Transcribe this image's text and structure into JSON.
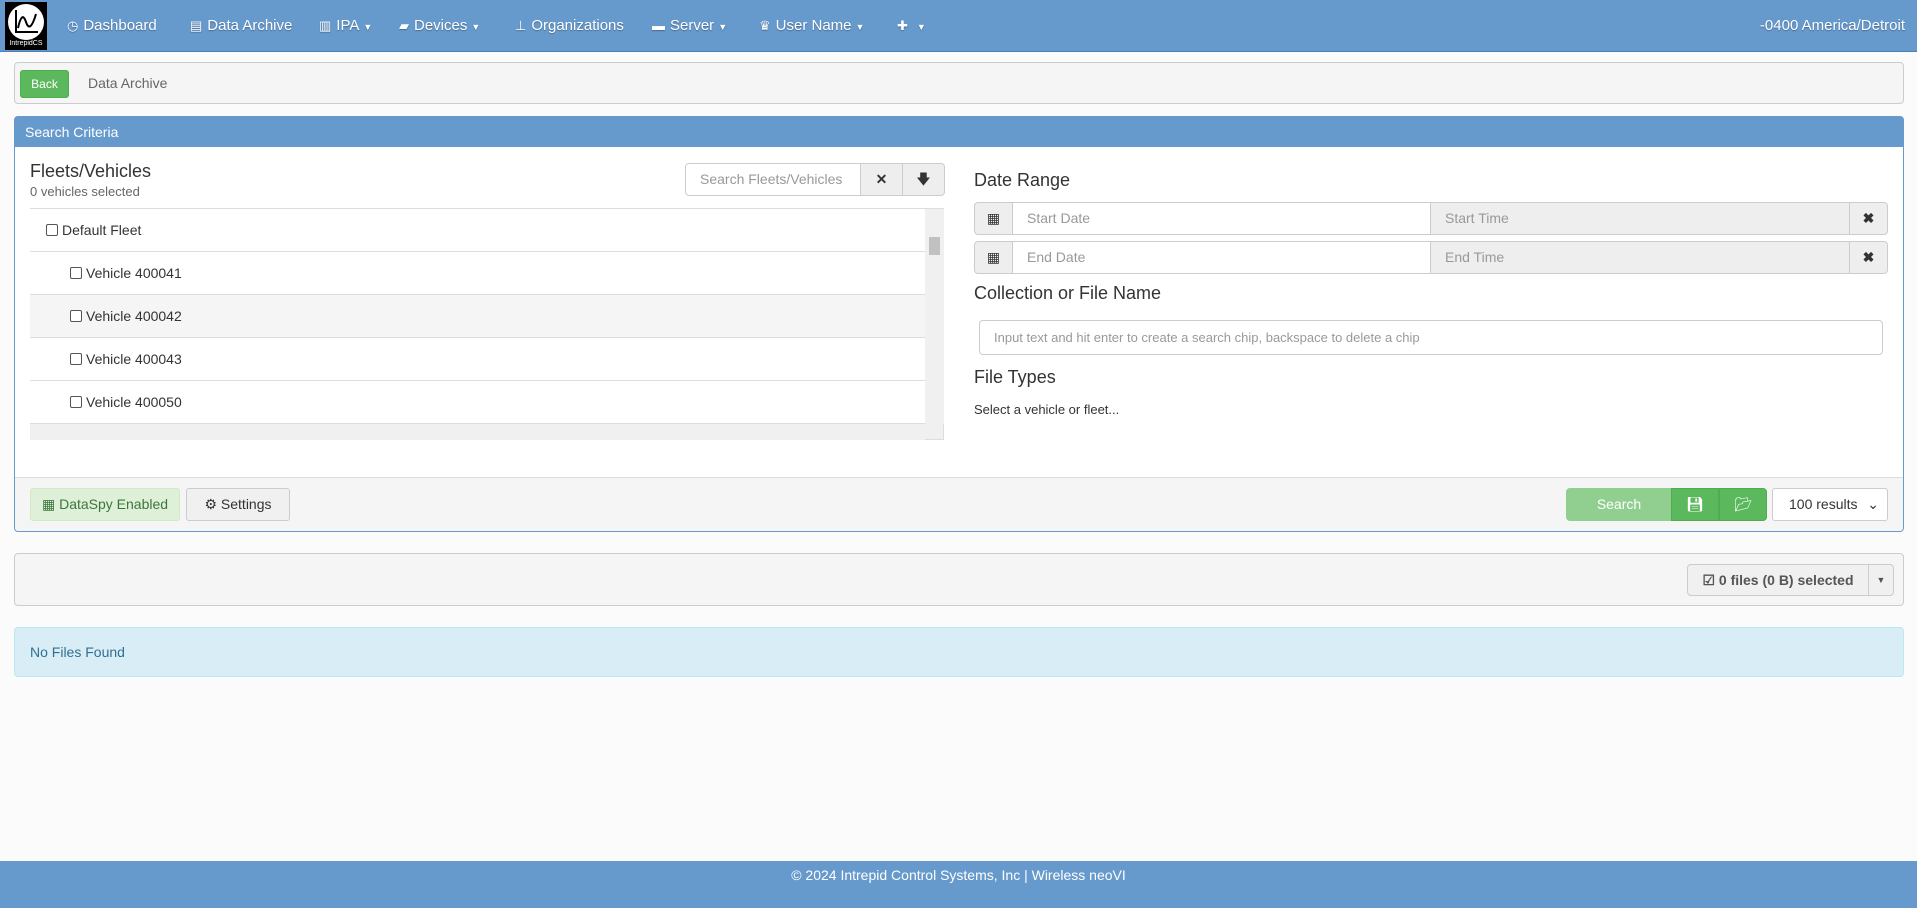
{
  "nav": {
    "logo_text": "IntrepidCS",
    "items": [
      {
        "label": "Dashboard",
        "icon": "dashboard-icon",
        "glyph": "◷",
        "caret": false
      },
      {
        "label": "Data Archive",
        "icon": "archive-icon",
        "glyph": "▤",
        "caret": false
      },
      {
        "label": "IPA",
        "icon": "beer-icon",
        "glyph": "▥",
        "caret": true
      },
      {
        "label": "Devices",
        "icon": "device-icon",
        "glyph": "▰",
        "caret": true
      },
      {
        "label": "Organizations",
        "icon": "sitemap-icon",
        "glyph": "⊥",
        "caret": false
      },
      {
        "label": "Server",
        "icon": "server-icon",
        "glyph": "▬",
        "caret": true
      },
      {
        "label": "User Name",
        "icon": "crown-icon",
        "glyph": "♛",
        "caret": true
      },
      {
        "label": "",
        "icon": "plus-icon",
        "glyph": "✚",
        "caret": true
      }
    ],
    "timezone": "-0400 America/Detroit"
  },
  "breadcrumb": {
    "back": "Back",
    "current": "Data Archive"
  },
  "search": {
    "header": "Search Criteria",
    "fleets": {
      "title": "Fleets/Vehicles",
      "count": "0 vehicles selected",
      "placeholder": "Search Fleets/Vehicles",
      "items": [
        "Default Fleet",
        "Vehicle 400041",
        "Vehicle 400042",
        "Vehicle 400043",
        "Vehicle 400050"
      ]
    },
    "date_range": {
      "title": "Date Range",
      "start_date": "Start Date",
      "start_time": "Start Time",
      "end_date": "End Date",
      "end_time": "End Time"
    },
    "collection": {
      "title": "Collection or File Name",
      "placeholder": "Input text and hit enter to create a search chip, backspace to delete a chip"
    },
    "file_types": {
      "title": "File Types",
      "message": "Select a vehicle or fleet..."
    },
    "dataspy": "DataSpy Enabled",
    "settings": "Settings",
    "search_button": "Search",
    "results": "100 results"
  },
  "files": {
    "selected": "0 files (0 B) selected",
    "empty": "No Files Found"
  },
  "footer": "© 2024 Intrepid Control Systems, Inc | Wireless neoVI",
  "colors": {
    "primary": "#6699cc",
    "success": "#5cb85c",
    "info_bg": "#d9edf7"
  }
}
